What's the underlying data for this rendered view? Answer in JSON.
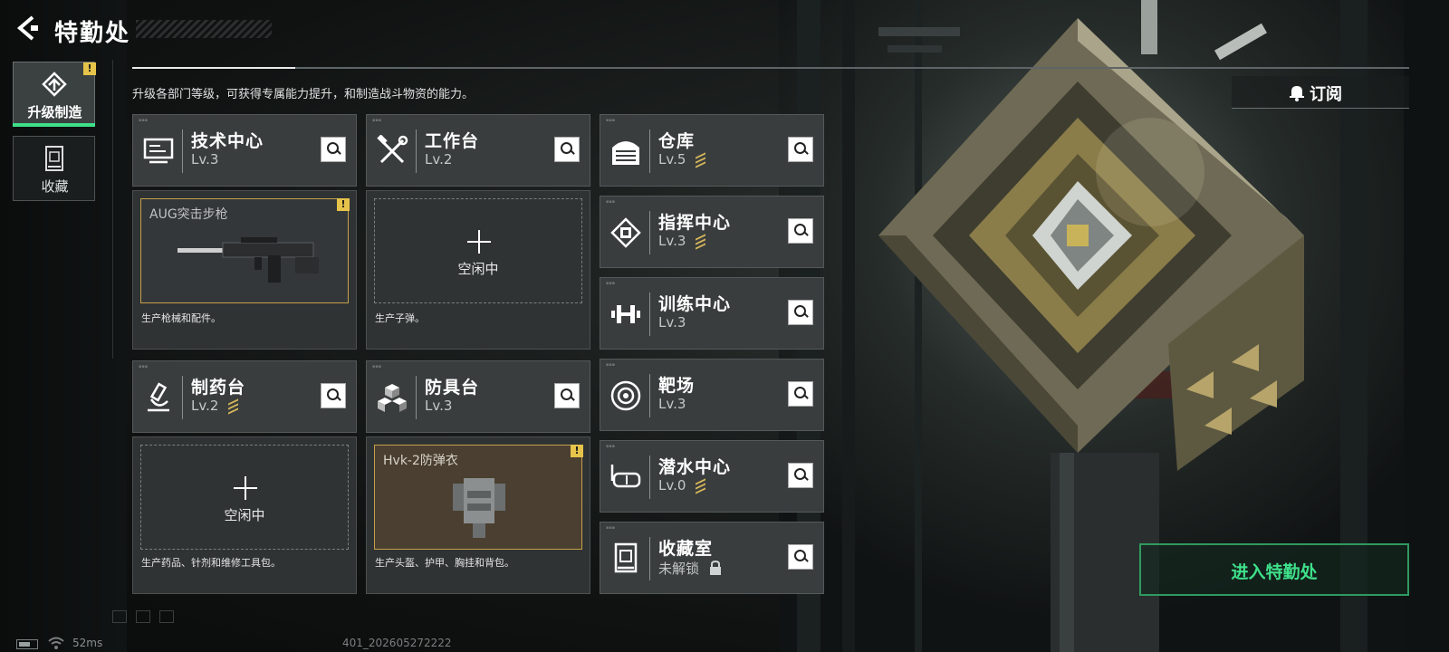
{
  "header": {
    "title": "特勤处"
  },
  "side": {
    "upgrade_label": "升级制造",
    "collect_label": "收藏"
  },
  "intro": "升级各部门等级，可获得专属能力提升，和制造战斗物资的能力。",
  "subscribe_label": "订阅",
  "enter_label": "进入特勤处",
  "departments": {
    "tech": {
      "name": "技术中心",
      "level": "Lv.3"
    },
    "workbench": {
      "name": "工作台",
      "level": "Lv.2"
    },
    "warehouse": {
      "name": "仓库",
      "level": "Lv.5"
    },
    "command": {
      "name": "指挥中心",
      "level": "Lv.3"
    },
    "training": {
      "name": "训练中心",
      "level": "Lv.3"
    },
    "pharmacy": {
      "name": "制药台",
      "level": "Lv.2"
    },
    "armor": {
      "name": "防具台",
      "level": "Lv.3"
    },
    "range": {
      "name": "靶场",
      "level": "Lv.3"
    },
    "diving": {
      "name": "潜水中心",
      "level": "Lv.0"
    },
    "collection": {
      "name": "收藏室",
      "level": "未解锁"
    }
  },
  "production": {
    "tech": {
      "item": "AUG突击步枪",
      "desc": "生产枪械和配件。"
    },
    "workbench": {
      "status": "空闲中",
      "desc": "生产子弹。"
    },
    "pharmacy": {
      "status": "空闲中",
      "desc": "生产药品、针剂和维修工具包。"
    },
    "armor": {
      "item": "Hvk-2防弹衣",
      "desc": "生产头盔、护甲、胸挂和背包。"
    }
  },
  "status": {
    "ping": "52ms",
    "build_id": "401_202605272222"
  },
  "colors": {
    "accent": "#3ee08a",
    "warning": "#e6c34a",
    "upgrade": "#d6b75a"
  }
}
